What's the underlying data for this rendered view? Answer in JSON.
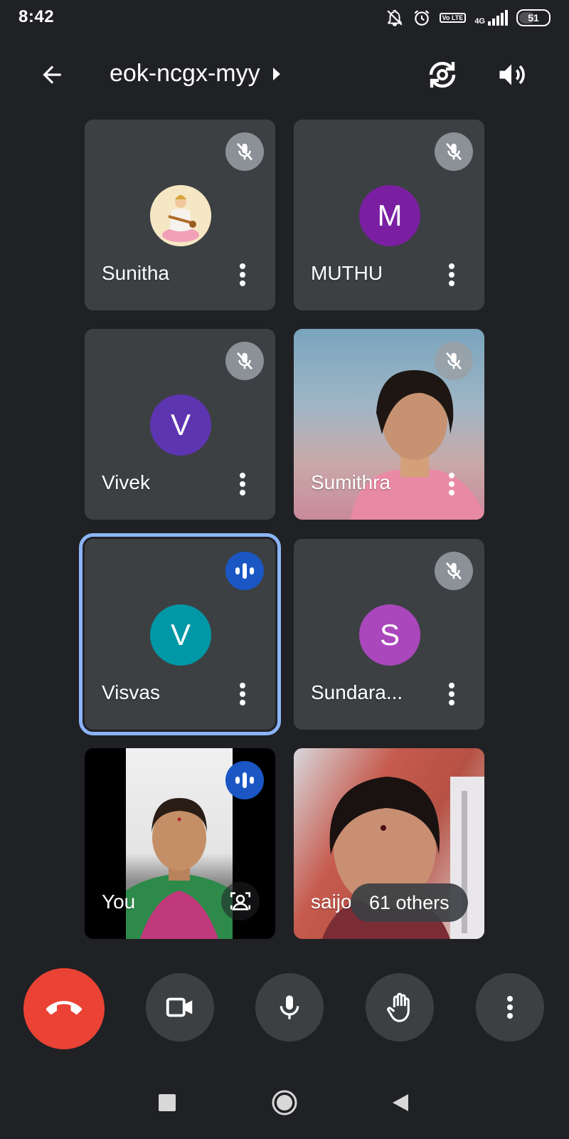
{
  "status_bar": {
    "time": "8:42",
    "network_type": "4G",
    "volte_label": "Vo LTE",
    "battery_level": "51",
    "icons": [
      "notifications-off-icon",
      "alarm-icon",
      "volte-icon",
      "signal-icon",
      "battery-icon"
    ]
  },
  "header": {
    "meeting_code": "eok-ncgx-myy",
    "icons": [
      "back-arrow-icon",
      "caret-right-icon",
      "switch-camera-icon",
      "speaker-icon"
    ]
  },
  "participants": [
    {
      "name": "Sunitha",
      "avatar_type": "image",
      "state": "muted"
    },
    {
      "name": "MUTHU",
      "avatar_letter": "M",
      "avatar_color": "#7b1fa2",
      "state": "muted"
    },
    {
      "name": "Vivek",
      "avatar_letter": "V",
      "avatar_color": "#5e35b1",
      "state": "muted"
    },
    {
      "name": "Sumithra",
      "avatar_type": "video",
      "state": "muted"
    },
    {
      "name": "Visvas",
      "avatar_letter": "V",
      "avatar_color": "#0097a7",
      "state": "speaking",
      "active": true
    },
    {
      "name": "Sundara...",
      "avatar_letter": "S",
      "avatar_color": "#ab47bc",
      "state": "muted"
    },
    {
      "name": "You",
      "avatar_type": "video",
      "state": "speaking"
    },
    {
      "name": "saijo",
      "avatar_type": "video",
      "overlay": "61 others"
    }
  ],
  "others_count_label": "61 others",
  "controls": {
    "end_call_color": "#ea4335",
    "items": [
      "end-call",
      "camera",
      "microphone",
      "raise-hand",
      "more-options"
    ]
  },
  "navbar": {
    "items": [
      "recents-square",
      "home-circle",
      "back-triangle"
    ]
  },
  "colors": {
    "background": "#202124",
    "tile": "#3c4043",
    "active_outline": "#8ab4f8",
    "speaking": "#1a57c4"
  }
}
